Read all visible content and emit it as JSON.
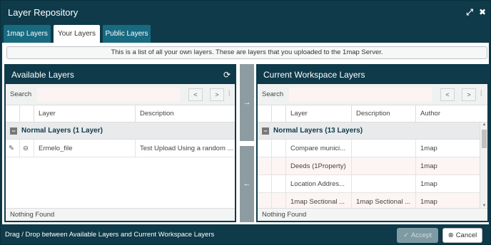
{
  "window": {
    "title": "Layer Repository"
  },
  "tabs": [
    {
      "label": "1map Layers"
    },
    {
      "label": "Your Layers"
    },
    {
      "label": "Public Layers"
    }
  ],
  "info_text": "This is a list of all your own layers. These are layers that you uploaded to the 1map Server.",
  "available": {
    "title": "Available Layers",
    "search_label": "Search",
    "search_value": "",
    "prev": "<",
    "next": ">",
    "columns": [
      "Layer",
      "Description"
    ],
    "group_label": "Normal Layers (1 Layer)",
    "rows": [
      {
        "layer": "Ermelo_file",
        "description": "Test Upload Using a random ..."
      }
    ],
    "footer": "Nothing Found"
  },
  "workspace": {
    "title": "Current Workspace Layers",
    "search_label": "Search",
    "search_value": "",
    "prev": "<",
    "next": ">",
    "columns": [
      "Layer",
      "Description",
      "Author"
    ],
    "group_label": "Normal Layers (13 Layers)",
    "rows": [
      {
        "layer": "Compare munici...",
        "description": "",
        "author": "1map"
      },
      {
        "layer": "Deeds (1Property)",
        "description": "",
        "author": "1map"
      },
      {
        "layer": "Location Addres...",
        "description": "",
        "author": "1map"
      },
      {
        "layer": "1map Sectional ...",
        "description": "1map Sectional ...",
        "author": "1map"
      }
    ],
    "footer": "Nothing Found"
  },
  "bottom": {
    "hint": "Drag / Drop between Available Layers and Current Workspace Layers",
    "accept_label": "Accept",
    "cancel_label": "Cancel"
  },
  "colors": {
    "header_bg": "#0e3a4a",
    "tab_bg": "#186a80",
    "accent_disabled": "#7e9ba4"
  },
  "icons": [
    "expand-icon",
    "close-icon",
    "refresh-icon",
    "edit-icon",
    "remove-icon",
    "arrow-right-icon",
    "arrow-left-icon",
    "check-icon",
    "cancel-icon"
  ]
}
